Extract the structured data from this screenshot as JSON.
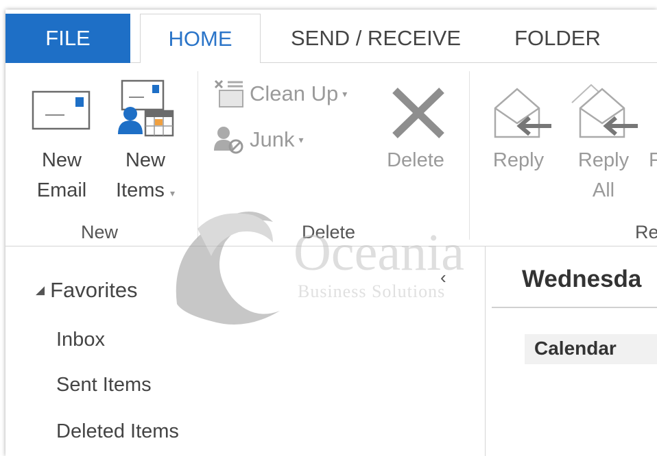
{
  "tabs": {
    "file": "FILE",
    "home": "HOME",
    "send_receive": "SEND / RECEIVE",
    "folder": "FOLDER"
  },
  "ribbon": {
    "new_group": {
      "label": "New",
      "new_email": "New\nEmail",
      "new_email_line1": "New",
      "new_email_line2": "Email",
      "new_items_line1": "New",
      "new_items_line2": "Items"
    },
    "delete_group": {
      "label": "Delete",
      "clean_up": "Clean Up",
      "junk": "Junk",
      "delete": "Delete"
    },
    "respond_group": {
      "label_partial": "Re",
      "reply": "Reply",
      "reply_all_line1": "Reply",
      "reply_all_line2": "All",
      "forward_partial": "F"
    }
  },
  "nav": {
    "favorites": "Favorites",
    "items": [
      "Inbox",
      "Sent Items",
      "Deleted Items"
    ]
  },
  "calendar": {
    "day_title": "Wednesda",
    "calendar_label": "Calendar"
  },
  "watermark": {
    "brand": "Oceania",
    "tagline": "Business Solutions"
  },
  "colors": {
    "file_tab": "#1e6fc6",
    "home_tab_text": "#2a74c8"
  }
}
